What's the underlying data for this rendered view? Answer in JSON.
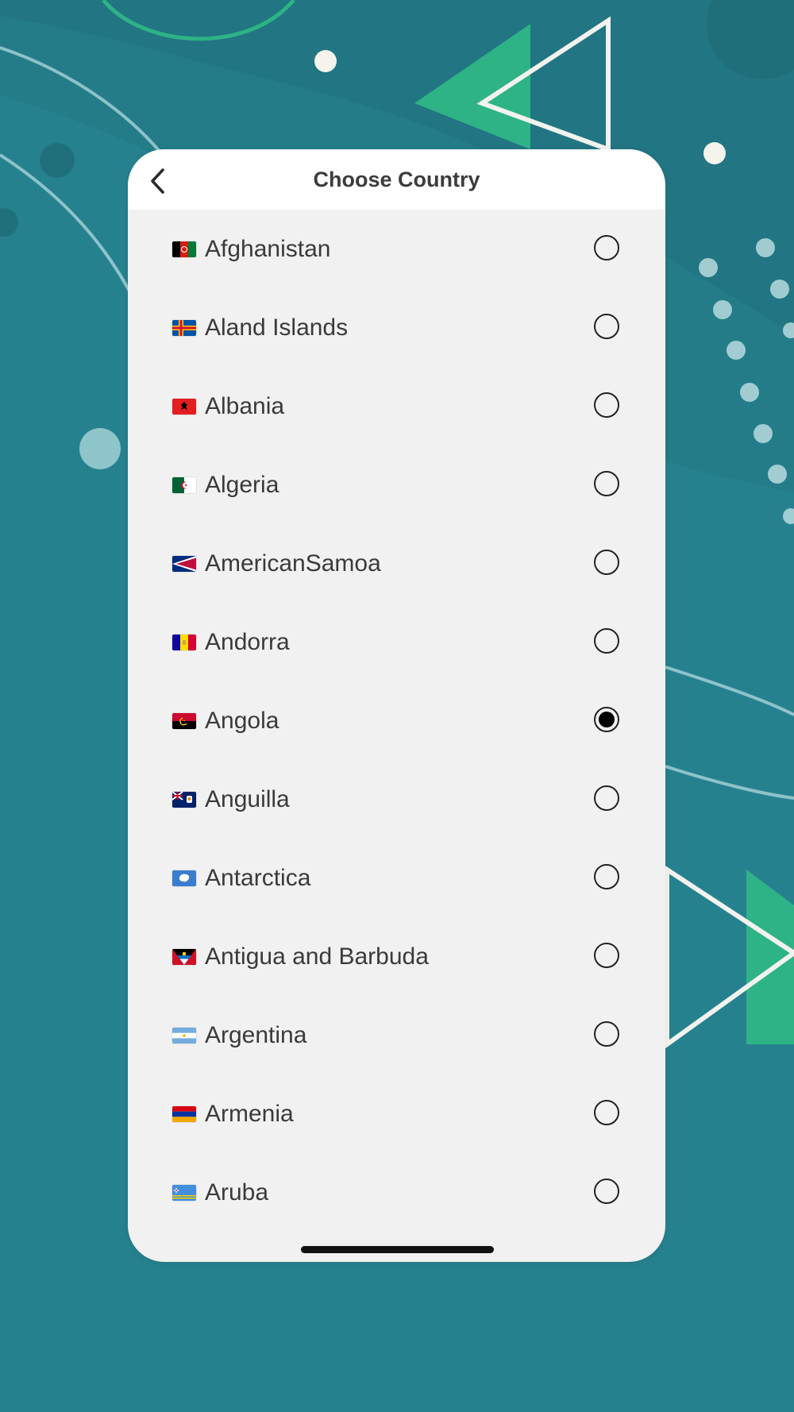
{
  "header": {
    "title": "Choose Country"
  },
  "icons": {
    "back": "chevron-left-icon"
  },
  "colors": {
    "background": "#26818f",
    "accent": "#2db386",
    "card": "#f1f1f1",
    "selected": "#000000"
  },
  "countries": [
    {
      "name": "Afghanistan",
      "flag": "afghanistan-flag-icon",
      "selected": false
    },
    {
      "name": "Aland Islands",
      "flag": "aland-islands-flag-icon",
      "selected": false
    },
    {
      "name": "Albania",
      "flag": "albania-flag-icon",
      "selected": false
    },
    {
      "name": "Algeria",
      "flag": "algeria-flag-icon",
      "selected": false
    },
    {
      "name": "AmericanSamoa",
      "flag": "american-samoa-flag-icon",
      "selected": false
    },
    {
      "name": "Andorra",
      "flag": "andorra-flag-icon",
      "selected": false
    },
    {
      "name": "Angola",
      "flag": "angola-flag-icon",
      "selected": true
    },
    {
      "name": "Anguilla",
      "flag": "anguilla-flag-icon",
      "selected": false
    },
    {
      "name": "Antarctica",
      "flag": "antarctica-flag-icon",
      "selected": false
    },
    {
      "name": "Antigua and Barbuda",
      "flag": "antigua-and-barbuda-flag-icon",
      "selected": false
    },
    {
      "name": "Argentina",
      "flag": "argentina-flag-icon",
      "selected": false
    },
    {
      "name": "Armenia",
      "flag": "armenia-flag-icon",
      "selected": false
    },
    {
      "name": "Aruba",
      "flag": "aruba-flag-icon",
      "selected": false
    }
  ]
}
